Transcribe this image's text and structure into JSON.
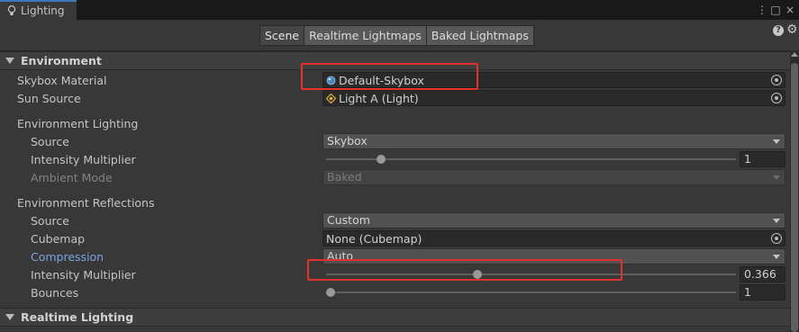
{
  "window": {
    "tab_title": "Lighting",
    "menu_glyph": "⋮",
    "maximize_glyph": "□",
    "close_glyph": "×"
  },
  "toolbar": {
    "tabs": [
      {
        "label": "Scene",
        "active": true
      },
      {
        "label": "Realtime Lightmaps",
        "active": false
      },
      {
        "label": "Baked Lightmaps",
        "active": false
      }
    ],
    "help_glyph": "?",
    "settings_glyph": "⚙"
  },
  "environment": {
    "header": "Environment",
    "skybox_material": {
      "label": "Skybox Material",
      "value": "Default-Skybox"
    },
    "sun_source": {
      "label": "Sun Source",
      "value": "Light A (Light)"
    },
    "lighting": {
      "label": "Environment Lighting",
      "source": {
        "label": "Source",
        "value": "Skybox"
      },
      "intensity": {
        "label": "Intensity Multiplier",
        "value": "1",
        "fraction": 0.125
      },
      "ambient_mode": {
        "label": "Ambient Mode",
        "value": "Baked",
        "disabled": true
      }
    },
    "reflections": {
      "label": "Environment Reflections",
      "source": {
        "label": "Source",
        "value": "Custom"
      },
      "cubemap": {
        "label": "Cubemap",
        "value": "None (Cubemap)"
      },
      "compression": {
        "label": "Compression",
        "value": "Auto"
      },
      "intensity": {
        "label": "Intensity Multiplier",
        "value": "0.366",
        "fraction": 0.366
      },
      "bounces": {
        "label": "Bounces",
        "value": "1",
        "fraction": 0.0
      }
    }
  },
  "realtime_lighting": {
    "header": "Realtime Lighting"
  },
  "colors": {
    "highlight": "#e5312d",
    "accent_tab": "#3a79bb",
    "link_label": "#7ba4e0"
  }
}
